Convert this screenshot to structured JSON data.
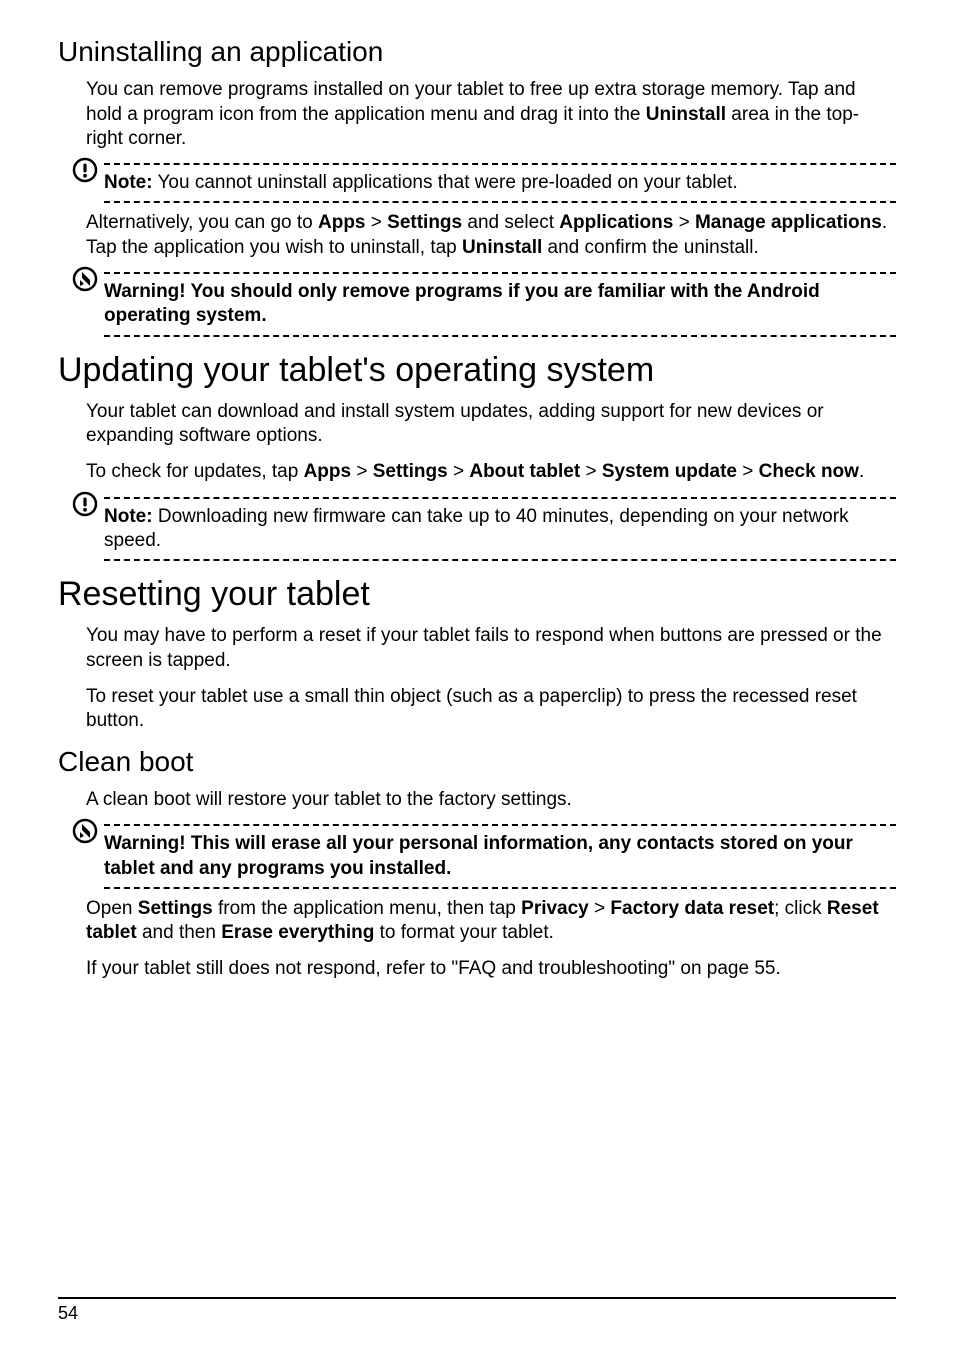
{
  "page_number": "54",
  "sections": {
    "uninstall": {
      "heading": "Uninstalling an application",
      "para1_parts": [
        "You can remove programs installed on your tablet to free up extra storage memory. Tap and hold a program icon from the application menu and drag it into the ",
        "Uninstall",
        " area in the top-right corner."
      ],
      "note1_label": "Note:",
      "note1_text": " You cannot uninstall applications that were pre-loaded on your tablet.",
      "para2_parts": [
        "Alternatively, you can go to ",
        "Apps",
        " > ",
        "Settings",
        " and select ",
        "Applications",
        " > ",
        "Manage applications",
        ". Tap the application you wish to uninstall, tap ",
        "Uninstall",
        " and confirm the uninstall."
      ],
      "warn1_text": "Warning! You should only remove programs if you are familiar with the Android operating system."
    },
    "updating": {
      "heading": "Updating your tablet's operating system",
      "para1": "Your tablet can download and install system updates, adding support for new devices or expanding software options.",
      "para2_parts": [
        "To check for updates, tap ",
        "Apps",
        " > ",
        "Settings",
        " > ",
        "About tablet",
        " > ",
        "System update",
        " > ",
        "Check now",
        "."
      ],
      "note1_label": "Note:",
      "note1_text": " Downloading new firmware can take up to 40 minutes, depending on your network speed."
    },
    "resetting": {
      "heading": "Resetting your tablet",
      "para1": "You may have to perform a reset if your tablet fails to respond when buttons are pressed or the screen is tapped.",
      "para2": "To reset your tablet use a small thin object (such as a paperclip) to press the recessed reset button."
    },
    "cleanboot": {
      "heading": "Clean boot",
      "para1": "A clean boot will restore your tablet to the factory settings.",
      "warn1_text": "Warning! This will erase all your personal information, any contacts stored on your tablet and any programs you installed.",
      "para2_parts": [
        "Open ",
        "Settings",
        " from the application menu, then tap ",
        "Privacy",
        " > ",
        "Factory data reset",
        "; click ",
        "Reset tablet",
        " and then ",
        "Erase everything",
        " to format your tablet."
      ],
      "para3": "If your tablet still does not respond, refer to \"FAQ and troubleshooting\" on page 55."
    }
  }
}
